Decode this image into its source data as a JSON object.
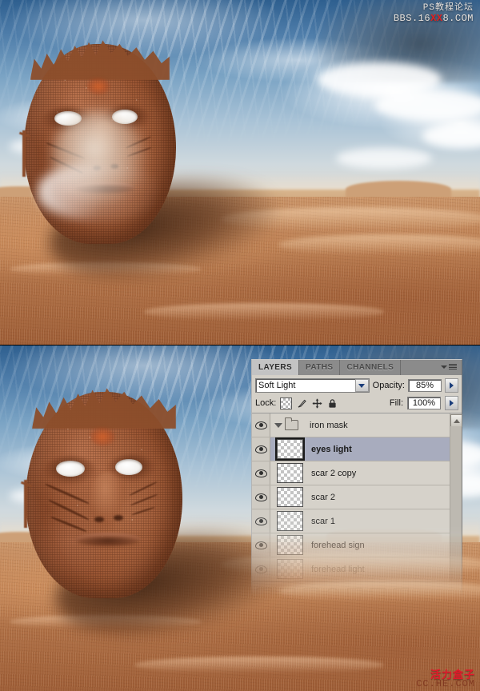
{
  "meta": {
    "title": "Photoshop tutorial screenshot - iron mask in desert",
    "accent_red": "#e2182a",
    "panel_bg": "#d4d0c8",
    "selected_row_bg": "#a8acbe"
  },
  "watermark_top": {
    "line1": "PS教程论坛",
    "line2_pre": "BBS.16",
    "line2_red": "XX",
    "line2_post": "8.COM"
  },
  "watermark_bottom": {
    "line1": "活力盒子",
    "line2": "CC.HE.COM"
  },
  "images": [
    {
      "name": "step-before",
      "caption": "Iron mask face half buried in desert sand with light veil over face"
    },
    {
      "name": "step-after",
      "caption": "Iron mask face with scars and defined features in desert sand"
    }
  ],
  "layers_panel": {
    "tabs": [
      {
        "label": "LAYERS",
        "active": true
      },
      {
        "label": "PATHS",
        "active": false
      },
      {
        "label": "CHANNELS",
        "active": false
      }
    ],
    "menu_icon": "panel-menu-icon",
    "blend_mode": {
      "value": "Soft Light",
      "icon": "chevron-down-icon"
    },
    "opacity": {
      "label": "Opacity:",
      "value": "85%",
      "stepper_icon": "triangle-right-icon"
    },
    "fill": {
      "label": "Fill:",
      "value": "100%",
      "stepper_icon": "triangle-right-icon"
    },
    "lock": {
      "label": "Lock:",
      "icons": [
        "lock-transparency-icon",
        "lock-image-pixels-brush-icon",
        "lock-position-move-icon",
        "lock-all-padlock-icon"
      ]
    },
    "scrollbar": {
      "up_arrow_icon": "scroll-up-arrow-icon"
    },
    "layers": [
      {
        "name": "iron mask",
        "type": "group",
        "visible": true,
        "selected": false,
        "faded": 0.0
      },
      {
        "name": "eyes light",
        "type": "layer",
        "visible": true,
        "selected": true,
        "faded": 0.0
      },
      {
        "name": "scar 2 copy",
        "type": "layer",
        "visible": true,
        "selected": false,
        "faded": 0.0
      },
      {
        "name": "scar 2",
        "type": "layer",
        "visible": true,
        "selected": false,
        "faded": 0.05
      },
      {
        "name": "scar 1",
        "type": "layer",
        "visible": true,
        "selected": false,
        "faded": 0.15
      },
      {
        "name": "forehead sign",
        "type": "layer",
        "visible": true,
        "selected": false,
        "faded": 0.35
      },
      {
        "name": "forehead light",
        "type": "layer",
        "visible": true,
        "selected": false,
        "faded": 0.62
      }
    ],
    "footer_buttons": [
      "link-layers-button",
      "layer-style-button",
      "layer-mask-button",
      "adjustment-layer-button",
      "new-group-button",
      "new-layer-button",
      "delete-layer-button"
    ]
  }
}
